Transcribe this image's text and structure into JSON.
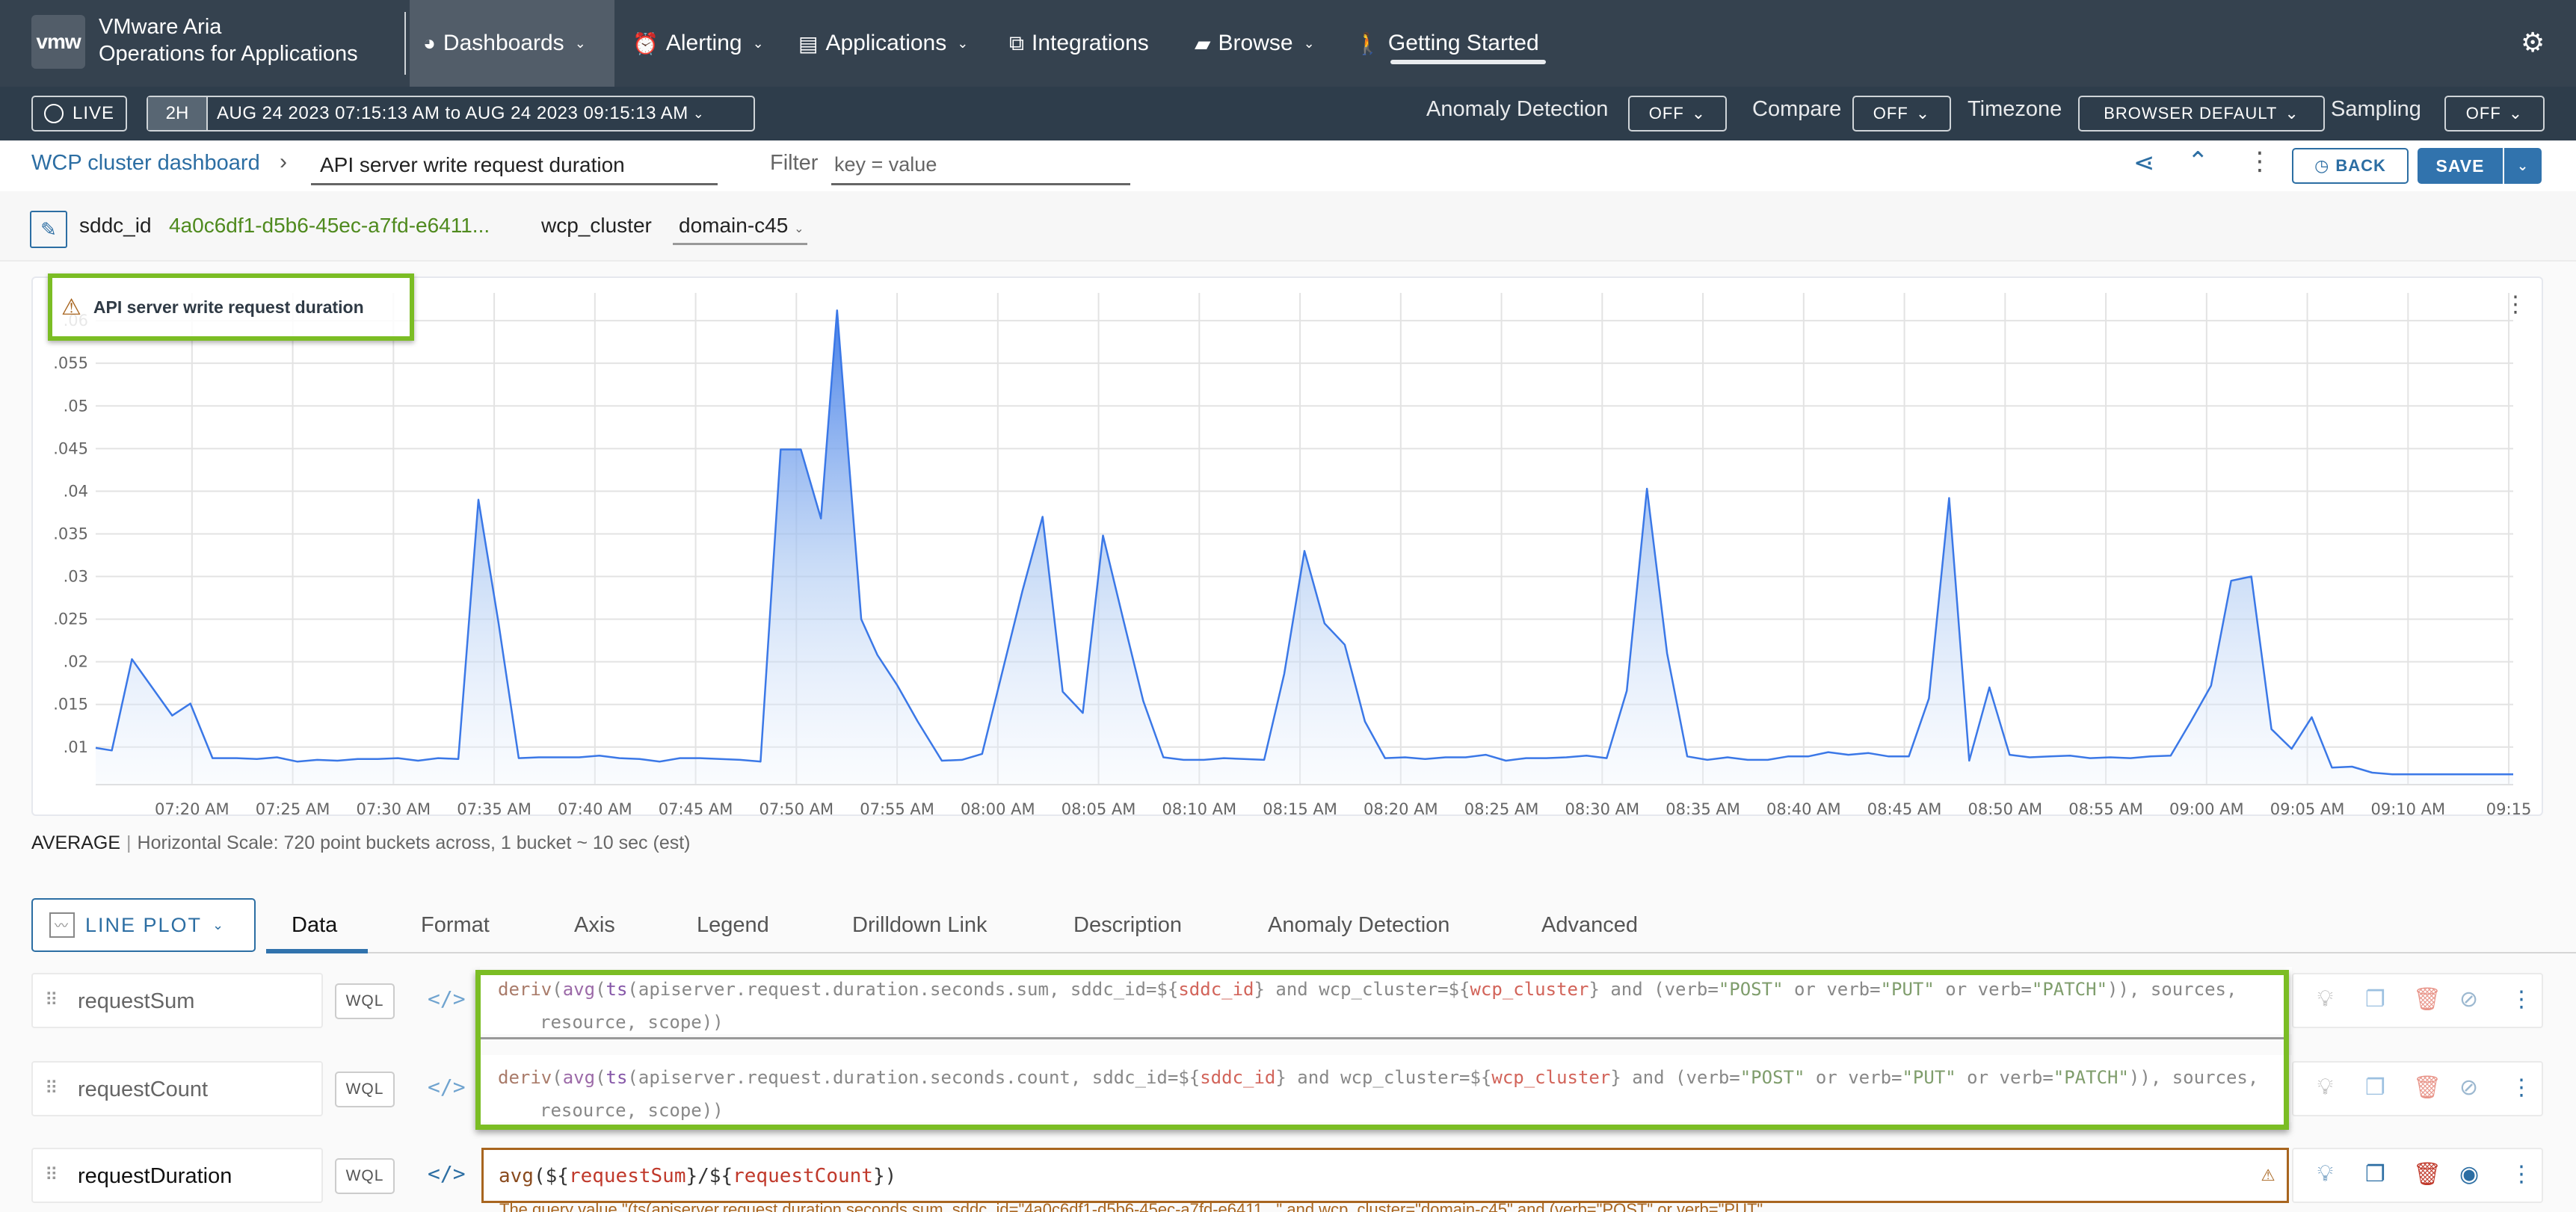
{
  "nav": {
    "logo": "vmw",
    "brand_line1": "VMware Aria",
    "brand_line2": "Operations for Applications",
    "items": [
      {
        "label": "Dashboards",
        "icon": "dashboard-gauge-icon",
        "dropdown": true,
        "active": true
      },
      {
        "label": "Alerting",
        "icon": "alarm-clock-icon",
        "dropdown": true
      },
      {
        "label": "Applications",
        "icon": "application-window-icon",
        "dropdown": true
      },
      {
        "label": "Integrations",
        "icon": "blocks-icon",
        "dropdown": false
      },
      {
        "label": "Browse",
        "icon": "folder-icon",
        "dropdown": true
      },
      {
        "label": "Getting Started",
        "icon": "hiker-icon",
        "dropdown": false
      }
    ],
    "settings_icon": "gear-icon"
  },
  "timebar": {
    "live_label": "LIVE",
    "range_preset": "2H",
    "range_text": "AUG 24 2023 07:15:13 AM  to  AUG 24 2023 09:15:13 AM",
    "anomaly_label": "Anomaly Detection",
    "anomaly_value": "OFF",
    "compare_label": "Compare",
    "compare_value": "OFF",
    "timezone_label": "Timezone",
    "timezone_value": "BROWSER DEFAULT",
    "sampling_label": "Sampling",
    "sampling_value": "OFF"
  },
  "breadcrumb": {
    "parent": "WCP cluster dashboard",
    "separator": "›",
    "chart_title_value": "API server write request duration",
    "filter_label": "Filter",
    "filter_placeholder": "key = value",
    "back_label": "BACK",
    "save_label": "SAVE"
  },
  "variables": [
    {
      "name": "sddc_id",
      "value": "4a0c6df1-d5b6-45ec-a7fd-e6411..."
    },
    {
      "name": "wcp_cluster",
      "value": "domain-c45"
    }
  ],
  "chart": {
    "title": "API server write request duration",
    "status_icon": "warning-icon"
  },
  "chart_data": {
    "type": "area",
    "title": "API server write request duration",
    "xlabel": "",
    "ylabel": "",
    "ylim": [
      0.0056,
      0.0615
    ],
    "y_ticks": [
      ".01",
      ".015",
      ".02",
      ".025",
      ".03",
      ".035",
      ".04",
      ".045",
      ".05",
      ".055",
      ".06"
    ],
    "y_tick_values": [
      0.01,
      0.015,
      0.02,
      0.025,
      0.03,
      0.035,
      0.04,
      0.045,
      0.05,
      0.055,
      0.06
    ],
    "x_ticks": [
      "07:20 AM",
      "07:25 AM",
      "07:30 AM",
      "07:35 AM",
      "07:40 AM",
      "07:45 AM",
      "07:50 AM",
      "07:55 AM",
      "08:00 AM",
      "08:05 AM",
      "08:10 AM",
      "08:15 AM",
      "08:20 AM",
      "08:25 AM",
      "08:30 AM",
      "08:35 AM",
      "08:40 AM",
      "08:45 AM",
      "08:50 AM",
      "08:55 AM",
      "09:00 AM",
      "09:05 AM",
      "09:10 AM",
      "09:15"
    ],
    "x_tick_minutes": [
      4.78,
      9.78,
      14.78,
      19.78,
      24.78,
      29.78,
      34.78,
      39.78,
      44.78,
      49.78,
      54.78,
      59.78,
      64.78,
      69.78,
      74.78,
      79.78,
      84.78,
      89.78,
      94.78,
      99.78,
      104.78,
      109.78,
      114.78,
      119.78
    ],
    "x_range_minutes": [
      0,
      120
    ],
    "grid": true,
    "legend": "none",
    "series": [
      {
        "name": "requestDuration",
        "color": "#3b78e7",
        "x_minutes": [
          0,
          0.8,
          1.8,
          3.8,
          4.7,
          5.8,
          7,
          8,
          9,
          10,
          11,
          12,
          13,
          14,
          15,
          16,
          17,
          18,
          19,
          20,
          21,
          22,
          23,
          24,
          25,
          26,
          27,
          28,
          29,
          30,
          31,
          32,
          33,
          34,
          35,
          36,
          36.8,
          38,
          38.8,
          39.8,
          40.8,
          42,
          43,
          44,
          45,
          46,
          47,
          48,
          49,
          50,
          51,
          52,
          53,
          54,
          55,
          56,
          57,
          58,
          59,
          60,
          61,
          62,
          63,
          64,
          65,
          66,
          67,
          68,
          69,
          70,
          71,
          72,
          73,
          74,
          75,
          76,
          77,
          78,
          79,
          80,
          81,
          82,
          83,
          84,
          85,
          86,
          87,
          88,
          89,
          90,
          91,
          92,
          93,
          94,
          95,
          96,
          97,
          98,
          99,
          100,
          101,
          102,
          103,
          104,
          105,
          106,
          107,
          108,
          109,
          110,
          111,
          112,
          113,
          114,
          115,
          116,
          117,
          118,
          119,
          120
        ],
        "values": [
          0.0099,
          0.0096,
          0.0203,
          0.0137,
          0.0151,
          0.0087,
          0.0087,
          0.0086,
          0.0088,
          0.0083,
          0.0085,
          0.0084,
          0.0086,
          0.0086,
          0.0087,
          0.0084,
          0.0087,
          0.0086,
          0.039,
          0.0245,
          0.0087,
          0.0088,
          0.0088,
          0.0088,
          0.009,
          0.0087,
          0.0086,
          0.0083,
          0.0087,
          0.0087,
          0.0086,
          0.0085,
          0.0083,
          0.0449,
          0.0449,
          0.0368,
          0.0612,
          0.025,
          0.0208,
          0.0172,
          0.013,
          0.0084,
          0.0085,
          0.0092,
          0.0188,
          0.0283,
          0.037,
          0.0165,
          0.014,
          0.0348,
          0.025,
          0.0154,
          0.0088,
          0.0085,
          0.0085,
          0.0087,
          0.0086,
          0.0085,
          0.0186,
          0.033,
          0.0245,
          0.022,
          0.013,
          0.0087,
          0.0088,
          0.0086,
          0.0088,
          0.0088,
          0.0091,
          0.0084,
          0.0087,
          0.0087,
          0.0088,
          0.009,
          0.0087,
          0.0166,
          0.0403,
          0.021,
          0.0089,
          0.0085,
          0.0088,
          0.0085,
          0.0085,
          0.0089,
          0.0089,
          0.0094,
          0.0091,
          0.0093,
          0.0089,
          0.0089,
          0.0157,
          0.0392,
          0.0084,
          0.017,
          0.0091,
          0.0088,
          0.0089,
          0.009,
          0.0087,
          0.0088,
          0.0087,
          0.0089,
          0.009,
          0.013,
          0.0172,
          0.0295,
          0.03,
          0.0121,
          0.0098,
          0.0135,
          0.0076,
          0.0077,
          0.007,
          0.0068,
          0.0068,
          0.0068,
          0.0068,
          0.0068,
          0.0068,
          0.0068
        ]
      }
    ]
  },
  "summary": {
    "aggregation": "AVERAGE",
    "scale_text": "Horizontal Scale: 720 point buckets across, 1 bucket ~ 10 sec (est)"
  },
  "editor": {
    "plot_type": "LINE PLOT",
    "tabs": [
      "Data",
      "Format",
      "Axis",
      "Legend",
      "Drilldown Link",
      "Description",
      "Anomaly Detection",
      "Advanced"
    ],
    "active_tab": "Data",
    "queries": [
      {
        "name": "requestSum",
        "language": "WQL",
        "line1": {
          "fn": "deriv",
          "agg": "avg",
          "ts": "ts",
          "metric": "(apiserver.request.duration.seconds.sum, sddc_id=${",
          "var1": "sddc_id",
          "mid": "} and wcp_cluster=${",
          "var2": "wcp_cluster",
          "mid2": "} and (verb=",
          "s1": "\"POST\"",
          "or1": " or verb=",
          "s2": "\"PUT\"",
          "or2": " or verb=",
          "s3": "\"PATCH\"",
          "tail": ")), sources,"
        },
        "line2": "resource, scope))",
        "visible": false
      },
      {
        "name": "requestCount",
        "language": "WQL",
        "line1": {
          "fn": "deriv",
          "agg": "avg",
          "ts": "ts",
          "metric": "(apiserver.request.duration.seconds.count, sddc_id=${",
          "var1": "sddc_id",
          "mid": "} and wcp_cluster=${",
          "var2": "wcp_cluster",
          "mid2": "} and (verb=",
          "s1": "\"POST\"",
          "or1": " or verb=",
          "s2": "\"PUT\"",
          "or2": " or verb=",
          "s3": "\"PATCH\"",
          "tail": ")), sources,"
        },
        "line2": "resource, scope))",
        "visible": false
      },
      {
        "name": "requestDuration",
        "language": "WQL",
        "expr": {
          "fn": "avg",
          "p1": "(${",
          "v1": "requestSum",
          "p2": "}/${",
          "v2": "requestCount",
          "p3": "})"
        },
        "visible": true
      }
    ],
    "warning_text": "The query value \"(ts(apiserver.request.duration.seconds.sum, sddc_id=\"4a0c6df1-d5b6-45ec-a7fd-e6411...\" and wcp_cluster=\"domain-c45\" and (verb=\"POST\" or verb=\"PUT\""
  }
}
